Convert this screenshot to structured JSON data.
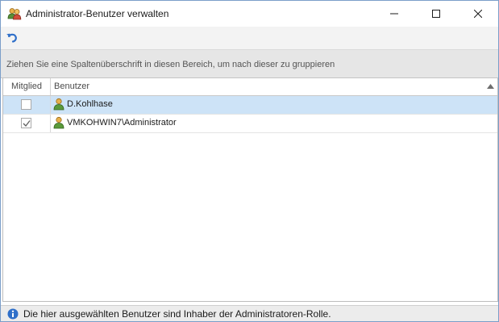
{
  "window": {
    "title": "Administrator-Benutzer verwalten",
    "icon": "users-icon"
  },
  "toolbar": {
    "undo_icon": "undo-icon"
  },
  "group_panel": {
    "hint": "Ziehen Sie eine Spaltenüberschrift in diesen Bereich, um nach dieser zu gruppieren"
  },
  "grid": {
    "columns": [
      {
        "label": "Mitglied"
      },
      {
        "label": "Benutzer",
        "sort": "ascending"
      }
    ],
    "rows": [
      {
        "member": false,
        "user": "D.Kohlhase",
        "selected": true
      },
      {
        "member": true,
        "user": "VMKOHWIN7\\Administrator",
        "selected": false
      }
    ]
  },
  "status": {
    "text": "Die hier ausgewählten Benutzer sind Inhaber der Administratoren-Rolle.",
    "icon": "info-icon"
  },
  "colors": {
    "selected_row": "#cde3f7",
    "accent": "#2f6fc9"
  }
}
